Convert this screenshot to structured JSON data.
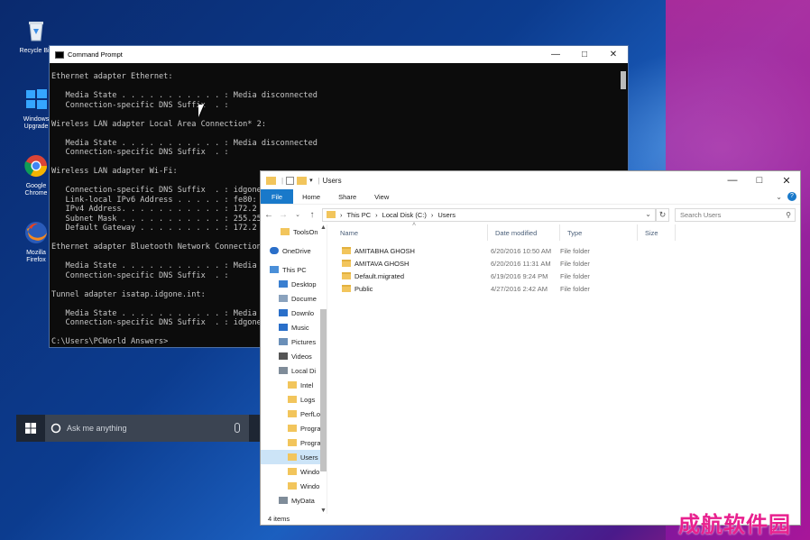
{
  "desktop": {
    "icons": [
      {
        "label": "Recycle Bin",
        "icon": "recycle-bin-icon"
      },
      {
        "label": "Windows Upgrade",
        "icon": "windows-icon"
      },
      {
        "label": "Google Chrome",
        "icon": "chrome-icon"
      },
      {
        "label": "Mozilla Firefox",
        "icon": "firefox-icon"
      }
    ],
    "watermark": "成航软件园"
  },
  "cmd": {
    "title": "Command Prompt",
    "lines": [
      "Ethernet adapter Ethernet:",
      "",
      "   Media State . . . . . . . . . . . : Media disconnected",
      "   Connection-specific DNS Suffix  . :",
      "",
      "Wireless LAN adapter Local Area Connection* 2:",
      "",
      "   Media State . . . . . . . . . . . : Media disconnected",
      "   Connection-specific DNS Suffix  . :",
      "",
      "Wireless LAN adapter Wi-Fi:",
      "",
      "   Connection-specific DNS Suffix  . : idgone",
      "   Link-local IPv6 Address . . . . . : fe80:",
      "   IPv4 Address. . . . . . . . . . . : 172.2",
      "   Subnet Mask . . . . . . . . . . . : 255.25",
      "   Default Gateway . . . . . . . . . : 172.2",
      "",
      "Ethernet adapter Bluetooth Network Connection",
      "",
      "   Media State . . . . . . . . . . . : Media",
      "   Connection-specific DNS Suffix  . :",
      "",
      "Tunnel adapter isatap.idgone.int:",
      "",
      "   Media State . . . . . . . . . . . : Media",
      "   Connection-specific DNS Suffix  . : idgone",
      "",
      "C:\\Users\\PCWorld Answers>"
    ]
  },
  "taskbar": {
    "search_placeholder": "Ask me anything"
  },
  "explorer": {
    "title": "Users",
    "ribbon_tabs": [
      "File",
      "Home",
      "Share",
      "View"
    ],
    "breadcrumb": [
      "This PC",
      "Local Disk (C:)",
      "Users"
    ],
    "search_placeholder": "Search Users",
    "nav_items": [
      {
        "label": "ToolsOn",
        "icon": "folder-icon",
        "indent": 1,
        "selected": false
      },
      {
        "label": "OneDrive",
        "icon": "cloud-icon",
        "indent": 0,
        "selected": false
      },
      {
        "label": "This PC",
        "icon": "computer-icon",
        "indent": 0,
        "selected": false
      },
      {
        "label": "Desktop",
        "icon": "desktop-icon",
        "indent": 1,
        "selected": false
      },
      {
        "label": "Docume",
        "icon": "document-icon",
        "indent": 1,
        "selected": false
      },
      {
        "label": "Downlo",
        "icon": "download-icon",
        "indent": 1,
        "selected": false
      },
      {
        "label": "Music",
        "icon": "music-icon",
        "indent": 1,
        "selected": false
      },
      {
        "label": "Pictures",
        "icon": "pictures-icon",
        "indent": 1,
        "selected": false
      },
      {
        "label": "Videos",
        "icon": "video-icon",
        "indent": 1,
        "selected": false
      },
      {
        "label": "Local Di",
        "icon": "drive-icon",
        "indent": 1,
        "selected": false
      },
      {
        "label": "Intel",
        "icon": "folder-icon",
        "indent": 2,
        "selected": false
      },
      {
        "label": "Logs",
        "icon": "folder-icon",
        "indent": 2,
        "selected": false
      },
      {
        "label": "PerfLo",
        "icon": "folder-icon",
        "indent": 2,
        "selected": false
      },
      {
        "label": "Progra",
        "icon": "folder-icon",
        "indent": 2,
        "selected": false
      },
      {
        "label": "Progra",
        "icon": "folder-icon",
        "indent": 2,
        "selected": false
      },
      {
        "label": "Users",
        "icon": "folder-icon",
        "indent": 2,
        "selected": true
      },
      {
        "label": "Windo",
        "icon": "folder-icon",
        "indent": 2,
        "selected": false
      },
      {
        "label": "Windo",
        "icon": "folder-icon",
        "indent": 2,
        "selected": false
      },
      {
        "label": "MyData",
        "icon": "drive-icon",
        "indent": 1,
        "selected": false
      }
    ],
    "columns": [
      "Name",
      "Date modified",
      "Type",
      "Size"
    ],
    "files": [
      {
        "name": "AMITABHA GHOSH",
        "date": "6/20/2016 10:50 AM",
        "type": "File folder"
      },
      {
        "name": "AMITAVA GHOSH",
        "date": "6/20/2016 11:31 AM",
        "type": "File folder"
      },
      {
        "name": "Default.migrated",
        "date": "6/19/2016 9:24 PM",
        "type": "File folder"
      },
      {
        "name": "Public",
        "date": "4/27/2016 2:42 AM",
        "type": "File folder"
      }
    ],
    "status": "4 items"
  },
  "colors": {
    "accent": "#1979ca",
    "folder": "#f2c55c",
    "selection": "#cce4f7",
    "cmd_bg": "#0c0c0c"
  }
}
